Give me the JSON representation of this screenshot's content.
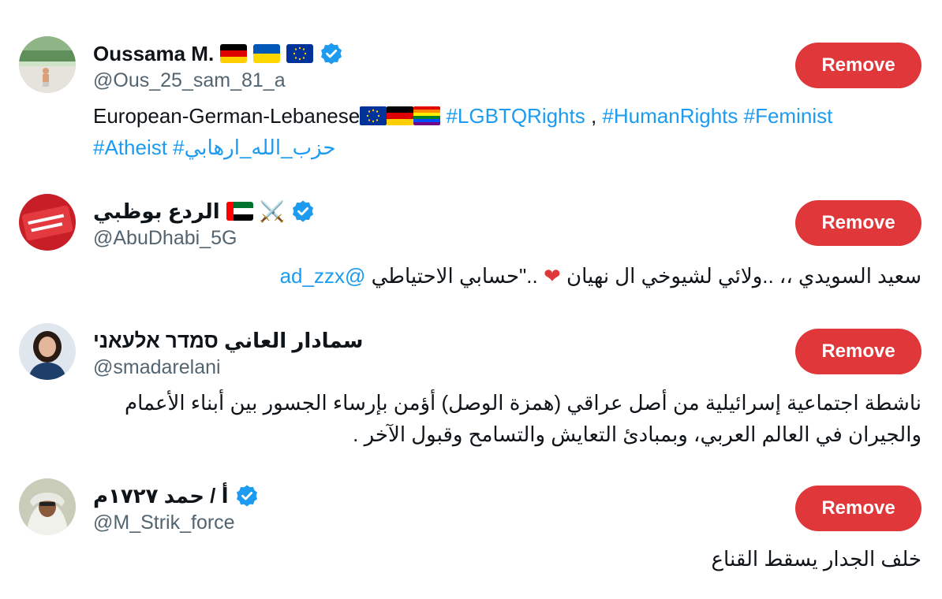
{
  "users": [
    {
      "display_name": "Oussama M.",
      "handle": "@Ous_25_sam_81_a",
      "verified": true,
      "name_flags": [
        "germany-flag",
        "ukraine-flag",
        "eu-flag"
      ],
      "bio_lead": "European-German-Lebanese",
      "bio_tags_line1": "#LGBTQRights",
      "bio_comma": " , ",
      "bio_tags_line1b": "#HumanRights #Feminist",
      "bio_tags_line2": "#Atheist #حزب_الله_ارهابي",
      "remove_label": "Remove"
    },
    {
      "display_name": "الردع بوظبي",
      "handle": "@AbuDhabi_5G",
      "verified": true,
      "name_icons": [
        "crossed-swords-icon",
        "uae-flag"
      ],
      "bio_text": "سعيد السويدي ،، ..ولائي لشيوخي ال نهيان",
      "bio_after_heart": " ..\"حسابي الاحتياطي ",
      "bio_mention": "@ad_zzx",
      "remove_label": "Remove"
    },
    {
      "display_name": "سمادار العاني סמדר אלעאני",
      "handle": "@smadarelani",
      "verified": false,
      "bio_text": "ناشطة اجتماعية إسرائيلية من أصل عراقي (همزة الوصل) أؤمن بإرساء الجسور بين أبناء الأعمام والجيران في العالم العربي، وبمبادئ التعايش والتسامح وقبول الآخر .",
      "remove_label": "Remove"
    },
    {
      "display_name": "أ / حمد ۱۷۲۷م",
      "handle": "@M_Strik_force",
      "verified": true,
      "bio_text": "خلف الجدار يسقط القناع",
      "remove_label": "Remove"
    }
  ],
  "colors": {
    "remove_button": "#e0373a",
    "link": "#1d9bf0",
    "verified": "#1d9bf0",
    "secondary_text": "#536471"
  }
}
